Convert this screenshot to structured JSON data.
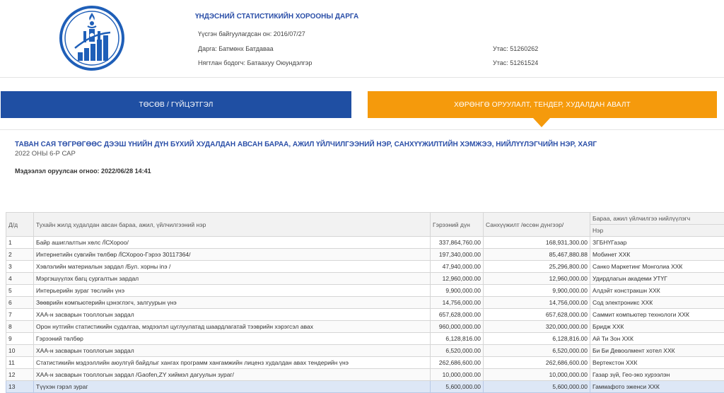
{
  "header": {
    "agency_title": "ҮНДЭСНИЙ СТАТИСТИКИЙН ХОРООНЫ ДАРГА",
    "established": "Үүсгэн байгуулагдсан он: 2016/07/27",
    "chairman": "Дарга: Батмөнх Батдаваа",
    "accountant": "Нягтлан бодогч: Батаахуу Оюундэлгэр",
    "phone1": "Утас: 51260262",
    "phone2": "Утас: 51261524",
    "logo_icon": "soyombo-emblem-icon"
  },
  "tabs": {
    "budget": "ТӨСӨВ / ГҮЙЦЭТГЭЛ",
    "procurement": "ХӨРӨНГӨ ОРУУЛАЛТ, ТЕНДЕР, ХУДАЛДАН АВАЛТ"
  },
  "report": {
    "title": "ТАВАН САЯ ТӨГРӨГӨӨС ДЭЭШ ҮНИЙН ДҮН БҮХИЙ ХУДАЛДАН АВСАН БАРАА, АЖИЛ ҮЙЛЧИЛГЭЭНИЙ НЭР, САНХҮҮЖИЛТИЙН ХЭМЖЭЭ, НИЙЛҮҮЛЭГЧИЙН НЭР, ХАЯГ",
    "period": "2022 ОНЫ 6-Р САР",
    "published": "Мэдээлэл оруулсан огноо: 2022/06/28 14:41"
  },
  "table": {
    "headers": {
      "no": "Д/д",
      "item": "Тухайн жилд худалдан авсан бараа, ажил, үйлчилгээний нэр",
      "contract": "Гэрээний дүн",
      "funding": "Санхүүжилт /өссөн дүнгээр/",
      "supplier": "Бараа, ажил үйлчилгээ нийлүүлэгч",
      "supplier_name": "Нэр"
    },
    "rows": [
      {
        "no": "1",
        "item": "Байр ашиглалтын хөлс /ЇСХороо/",
        "contract": "337,864,760.00",
        "funding": "168,931,300.00",
        "supplier": "ЗГБНҮГазар"
      },
      {
        "no": "2",
        "item": "Интернетийн сувгийн төлбөр /ЇСХороо-Гэрээ 30117364/",
        "contract": "197,340,000.00",
        "funding": "85,467,880.88",
        "supplier": "Мобинет ХХК"
      },
      {
        "no": "3",
        "item": "Хэвлэлийн материалын зардал /Бул. хорны іnэ /",
        "contract": "47,940,000.00",
        "funding": "25,296,800.00",
        "supplier": "Санко Маркетинг Монголиа ХХК"
      },
      {
        "no": "4",
        "item": "Мэргэшүүлэх багц сургалтын зардал",
        "contract": "12,960,000.00",
        "funding": "12,960,000.00",
        "supplier": "Удирдлагын академи УТҮГ"
      },
      {
        "no": "5",
        "item": "Интерьерийн зураг төслийн үнэ",
        "contract": "9,900,000.00",
        "funding": "9,900,000.00",
        "supplier": "Алдэйт констракшн ХХК"
      },
      {
        "no": "6",
        "item": "Зөөврийн компьютерийн цэнэглэгч, залгуурын үнэ",
        "contract": "14,756,000.00",
        "funding": "14,756,000.00",
        "supplier": "Сод электроникс ХХК"
      },
      {
        "no": "7",
        "item": "ХАА-н засварын тооллогын зардал",
        "contract": "657,628,000.00",
        "funding": "657,628,000.00",
        "supplier": "Саммит компьютер технологи ХХК"
      },
      {
        "no": "8",
        "item": "Орон нутгийн статистикийн судалгаа, мэдээлэл цуглуулатад шаардлагатай тээврийн хэрэгсэл авах",
        "contract": "960,000,000.00",
        "funding": "320,000,000.00",
        "supplier": "Бридж ХХК"
      },
      {
        "no": "9",
        "item": "Гэрээний төлбөр",
        "contract": "6,128,816.00",
        "funding": "6,128,816.00",
        "supplier": "Ай Ти Зон ХХК"
      },
      {
        "no": "10",
        "item": "ХАА-н засварын тооллогын зардал",
        "contract": "6,520,000.00",
        "funding": "6,520,000.00",
        "supplier": "Би Би Девоолмент хотел ХХК"
      },
      {
        "no": "11",
        "item": "Статистикийн мэдээллийн аюулгүй байдлыг хангах программ хангамжийн лиценз худалдан авах тендерийн үнэ",
        "contract": "262,686,600.00",
        "funding": "262,686,600.00",
        "supplier": "Вертекстон ХХК"
      },
      {
        "no": "12",
        "item": "ХАА-н засварын тооллогын зардал /Gaofen,ZY хиймэл дагуулын зураг/",
        "contract": "10,000,000.00",
        "funding": "10,000,000.00",
        "supplier": "Газар зүй, Гео-эко хурээлэн"
      },
      {
        "no": "13",
        "item": "Түүхэн гэрэл зураг",
        "contract": "5,600,000.00",
        "funding": "5,600,000.00",
        "supplier": "Гаммафото эженси ХХК"
      }
    ]
  },
  "colors": {
    "blue": "#1f4fa3",
    "orange": "#f59a0c",
    "title_blue": "#2b4fa8"
  }
}
